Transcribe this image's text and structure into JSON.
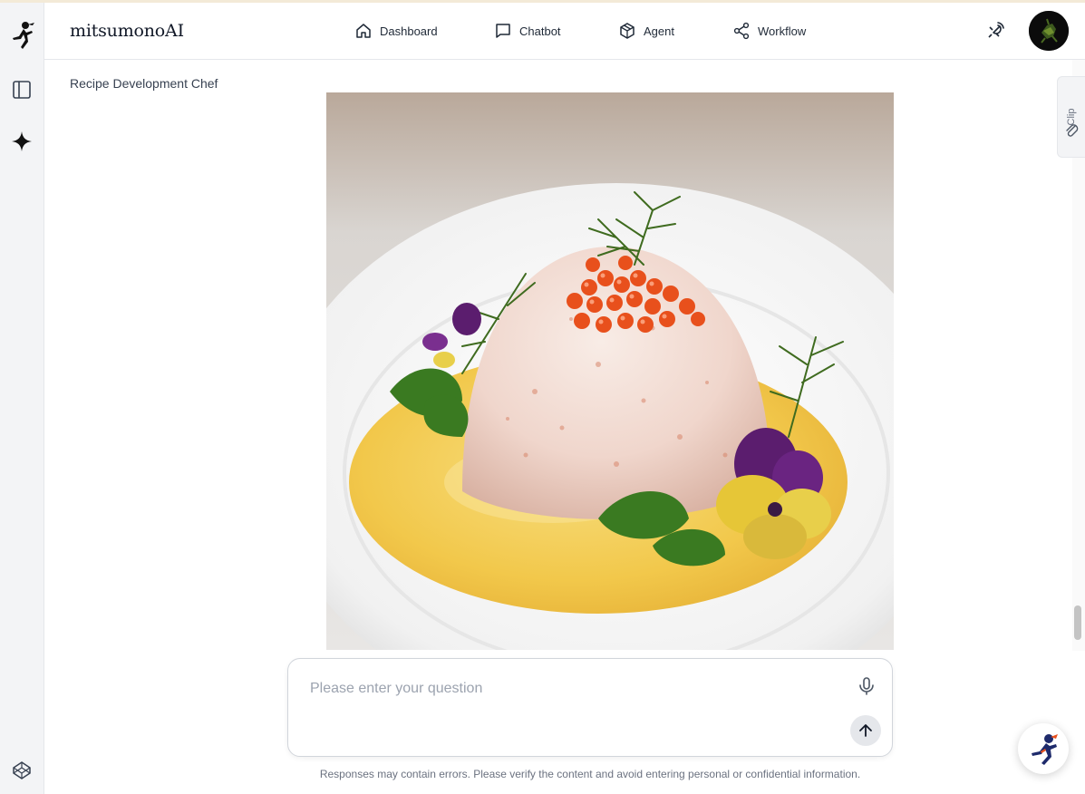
{
  "app": {
    "brand": "mitsumonoAI"
  },
  "nav": [
    {
      "label": "Dashboard",
      "icon": "home-icon"
    },
    {
      "label": "Chatbot",
      "icon": "chat-bubble-icon"
    },
    {
      "label": "Agent",
      "icon": "cube-icon"
    },
    {
      "label": "Workflow",
      "icon": "share-nodes-icon"
    }
  ],
  "page": {
    "title": "Recipe Development Chef"
  },
  "image": {
    "alt": "food-photo"
  },
  "clip_tab": {
    "label": "Clip",
    "icon": "paperclip-icon"
  },
  "composer": {
    "placeholder": "Please enter your question",
    "mic_icon": "microphone-icon",
    "send_icon": "arrow-up-icon"
  },
  "disclaimer": "Responses may contain errors. Please verify the content and avoid entering personal or confidential information.",
  "colors": {
    "accent": "#111827",
    "sauce": "#f2c84b",
    "roe": "#e8501c"
  }
}
